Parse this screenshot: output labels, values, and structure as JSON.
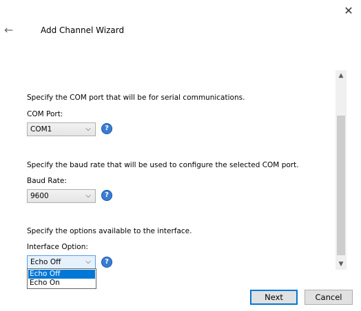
{
  "window": {
    "title": "Add Channel Wizard"
  },
  "sections": {
    "com": {
      "description": "Specify the COM port that will be for serial communications.",
      "label": "COM Port:",
      "value": "COM1"
    },
    "baud": {
      "description": "Specify the baud rate that will be used to configure the selected COM port.",
      "label": "Baud Rate:",
      "value": "9600"
    },
    "interface": {
      "description": "Specify the options available to the interface.",
      "label": "Interface Option:",
      "value": "Echo Off",
      "options": [
        "Echo Off",
        "Echo On"
      ]
    }
  },
  "buttons": {
    "next": "Next",
    "cancel": "Cancel"
  },
  "icons": {
    "close": "close-icon",
    "back": "back-arrow-icon",
    "help": "help-icon",
    "dropdown": "chevron-down-icon"
  },
  "colors": {
    "selection": "#0078d7",
    "help": "#3a7bd5"
  }
}
